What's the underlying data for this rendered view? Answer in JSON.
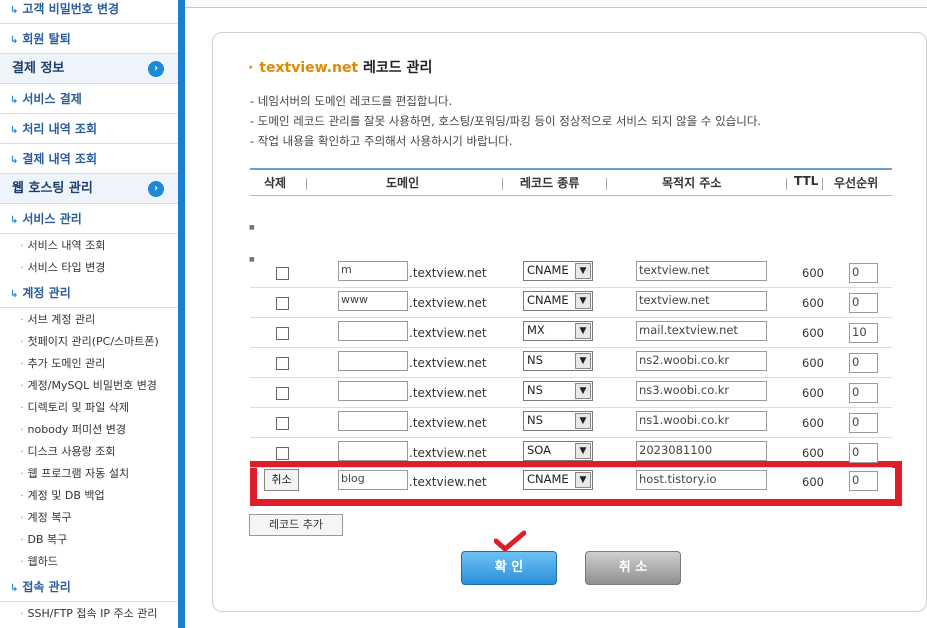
{
  "sidebar": {
    "menus": [
      {
        "label": "고객 비밀번호 변경",
        "type": "menu"
      },
      {
        "label": "회원 탈퇴",
        "type": "menu"
      },
      {
        "label": "결제 정보",
        "type": "category"
      },
      {
        "label": "서비스 결제",
        "type": "menu"
      },
      {
        "label": "처리 내역 조회",
        "type": "menu"
      },
      {
        "label": "결제 내역 조회",
        "type": "menu"
      },
      {
        "label": "웹 호스팅 관리",
        "type": "category"
      },
      {
        "label": "서비스 관리",
        "type": "menu"
      },
      {
        "label": "서비스 내역 조회",
        "type": "sub"
      },
      {
        "label": "서비스 타입 변경",
        "type": "sub"
      },
      {
        "label": "계정 관리",
        "type": "menu"
      },
      {
        "label": "서브 계정 관리",
        "type": "sub"
      },
      {
        "label": "첫페이지 관리(PC/스마트폰)",
        "type": "sub"
      },
      {
        "label": "추가 도메인 관리",
        "type": "sub"
      },
      {
        "label": "계정/MySQL 비밀번호 변경",
        "type": "sub"
      },
      {
        "label": "디렉토리 및 파일 삭제",
        "type": "sub"
      },
      {
        "label": "nobody 퍼미션 변경",
        "type": "sub"
      },
      {
        "label": "디스크 사용량 조회",
        "type": "sub"
      },
      {
        "label": "웹 프로그램 자동 설치",
        "type": "sub"
      },
      {
        "label": "계정 및 DB 백업",
        "type": "sub"
      },
      {
        "label": "계정 복구",
        "type": "sub"
      },
      {
        "label": "DB 복구",
        "type": "sub"
      },
      {
        "label": "웹하드",
        "type": "sub"
      },
      {
        "label": "접속 관리",
        "type": "menu"
      },
      {
        "label": "SSH/FTP 접속 IP 주소 관리",
        "type": "sub"
      }
    ]
  },
  "panel": {
    "title_brand": "textview.net",
    "title_rest": "레코드 관리",
    "notices": [
      "- 네임서버의 도메인 레코드를 편집합니다.",
      "- 도메인 레코드 관리를 잘못 사용하면, 호스팅/포워딩/파킹 등이 정상적으로 서비스 되지 않을 수 있습니다.",
      "- 작업 내용을 확인하고 주의해서 사용하시기 바랍니다."
    ]
  },
  "table": {
    "headers": {
      "delete": "삭제",
      "domain": "도메인",
      "record_type": "레코드 종류",
      "destination": "목적지 주소",
      "ttl": "TTL",
      "priority": "우선순위"
    },
    "domain_suffix": ".textview.net",
    "rows": [
      {
        "host": "m",
        "type": "CNAME",
        "dest": "textview.net",
        "ttl": "600",
        "priority": "0"
      },
      {
        "host": "www",
        "type": "CNAME",
        "dest": "textview.net",
        "ttl": "600",
        "priority": "0"
      },
      {
        "host": "",
        "type": "MX",
        "dest": "mail.textview.net",
        "ttl": "600",
        "priority": "10"
      },
      {
        "host": "",
        "type": "NS",
        "dest": "ns2.woobi.co.kr",
        "ttl": "600",
        "priority": "0"
      },
      {
        "host": "",
        "type": "NS",
        "dest": "ns3.woobi.co.kr",
        "ttl": "600",
        "priority": "0"
      },
      {
        "host": "",
        "type": "NS",
        "dest": "ns1.woobi.co.kr",
        "ttl": "600",
        "priority": "0"
      },
      {
        "host": "",
        "type": "SOA",
        "dest": "2023081100",
        "ttl": "600",
        "priority": "0"
      }
    ],
    "new_row": {
      "cancel_label": "취소",
      "host": "blog",
      "type": "CNAME",
      "dest": "host.tistory.io",
      "ttl": "600",
      "priority": "0"
    }
  },
  "buttons": {
    "add_record": "레코드 추가",
    "confirm": "확 인",
    "cancel": "취 소"
  },
  "colors": {
    "accent_blue": "#1b7fcf",
    "highlight_red": "#e01e2a",
    "brand_orange": "#e08a00"
  }
}
